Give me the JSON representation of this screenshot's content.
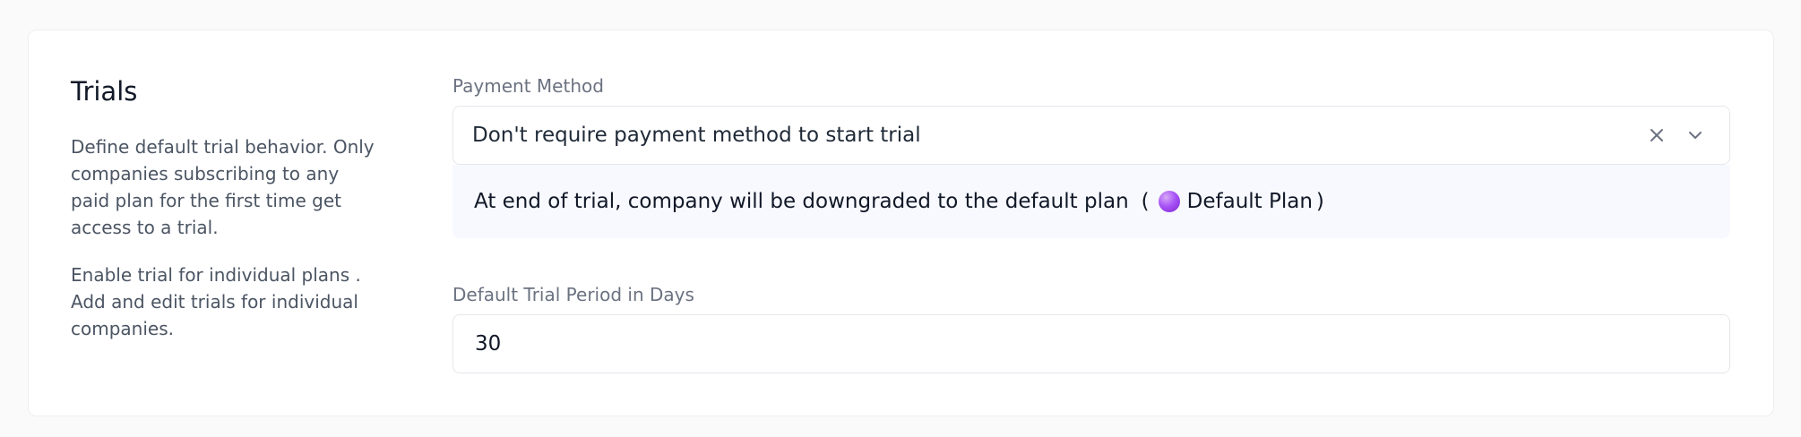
{
  "section": {
    "title": "Trials",
    "description": "Define default trial behavior. Only companies subscribing to any paid plan for the first time get access to a trial.",
    "description2": "Enable trial for individual plans . Add and edit trials for individual companies."
  },
  "payment_method": {
    "label": "Payment Method",
    "value": "Don't require payment method to start trial",
    "clear_icon": "close-icon",
    "dropdown_icon": "chevron-down-icon"
  },
  "notice": {
    "text": "At end of trial, company will be downgraded to the default plan",
    "paren_open": "(",
    "plan_name": "Default Plan",
    "paren_close": ")",
    "plan_color": "#a855f7"
  },
  "trial_period": {
    "label": "Default Trial Period in Days",
    "value": "30"
  }
}
